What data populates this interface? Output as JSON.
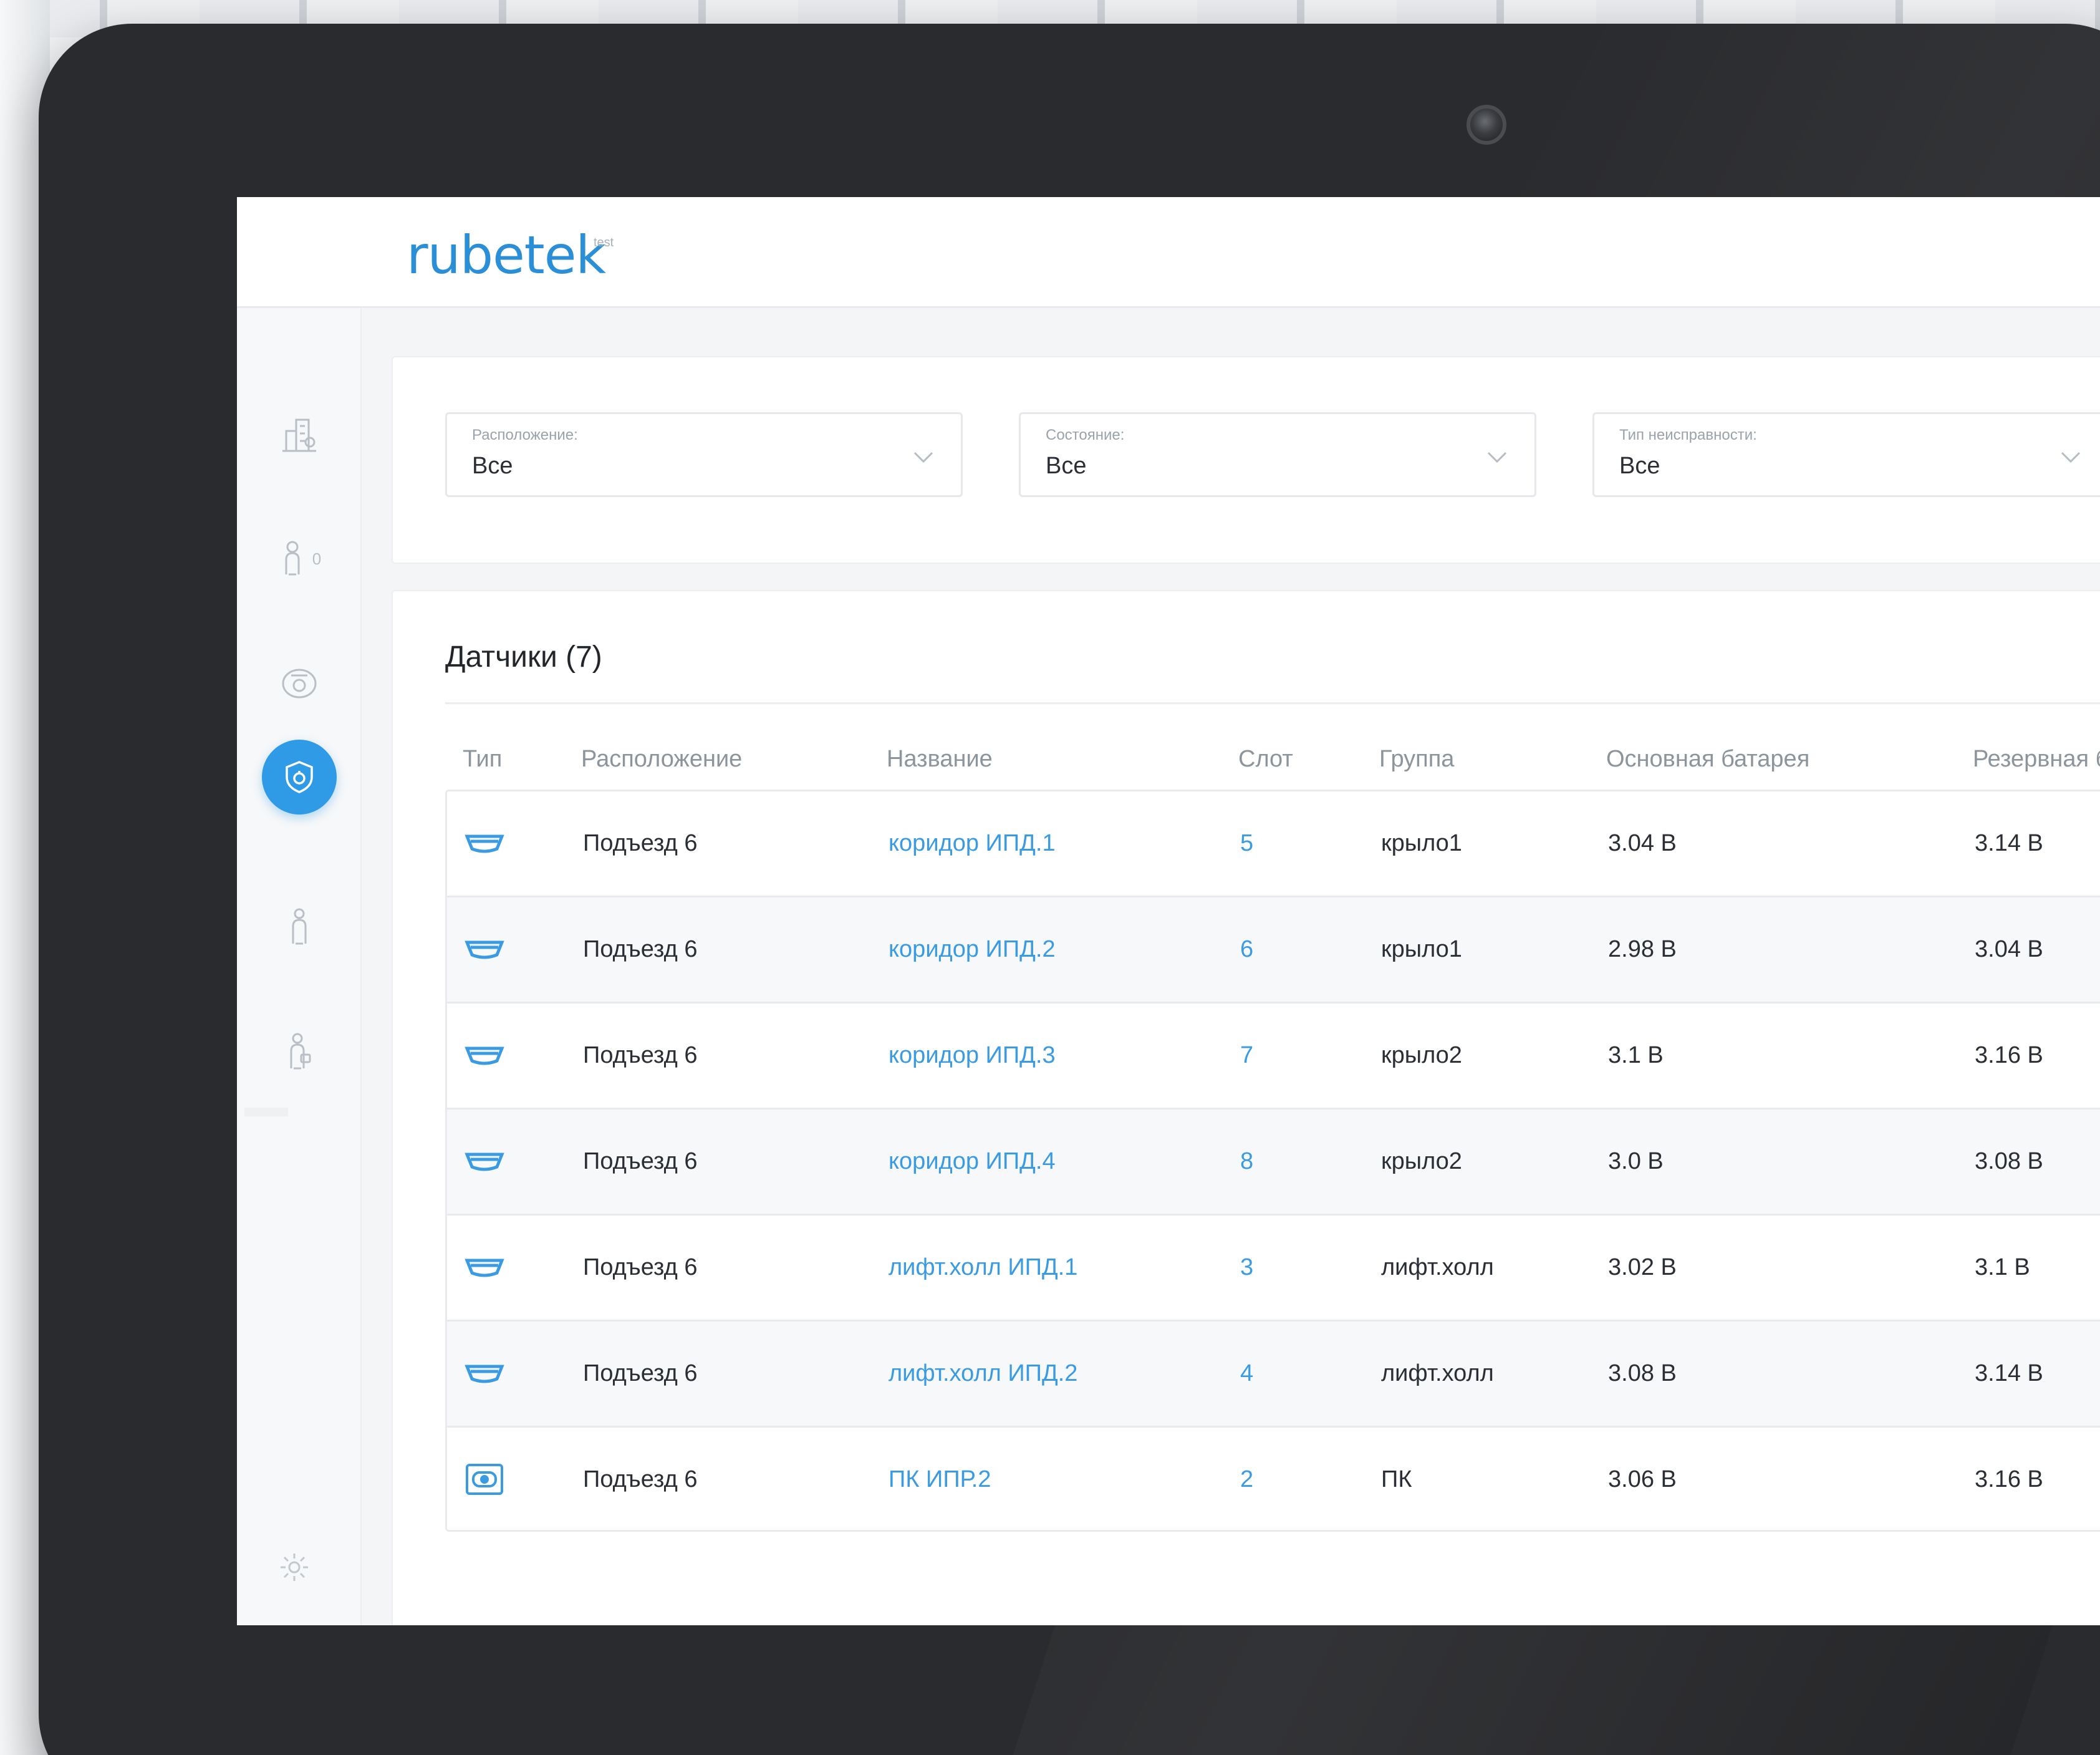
{
  "app": {
    "logo": "rubetek",
    "logo_sup": "test"
  },
  "sidebar": {
    "items": [
      {
        "icon": "building-icon"
      },
      {
        "icon": "residents-icon",
        "badge": "0"
      },
      {
        "icon": "camera-dome-icon"
      },
      {
        "icon": "shield-sensor-icon",
        "active": true
      },
      {
        "icon": "person-icon"
      },
      {
        "icon": "person-key-icon"
      }
    ],
    "footer_icon": "gear-icon"
  },
  "filters": [
    {
      "label": "Расположение:",
      "value": "Все"
    },
    {
      "label": "Состояние:",
      "value": "Все"
    },
    {
      "label": "Тип неисправности:",
      "value": "Все"
    }
  ],
  "table": {
    "title": "Датчики (7)",
    "columns": [
      "Тип",
      "Расположение",
      "Название",
      "Слот",
      "Группа",
      "Основная батарея",
      "Резервная бата"
    ],
    "rows": [
      {
        "type": "smoke-detector-icon",
        "location": "Подъезд 6",
        "name": "коридор ИПД.1",
        "slot": "5",
        "group": "крыло1",
        "main_battery": "3.04 В",
        "backup_battery": "3.14 В"
      },
      {
        "type": "smoke-detector-icon",
        "location": "Подъезд 6",
        "name": "коридор ИПД.2",
        "slot": "6",
        "group": "крыло1",
        "main_battery": "2.98 В",
        "backup_battery": "3.04 В"
      },
      {
        "type": "smoke-detector-icon",
        "location": "Подъезд 6",
        "name": "коридор ИПД.3",
        "slot": "7",
        "group": "крыло2",
        "main_battery": "3.1 В",
        "backup_battery": "3.16 В"
      },
      {
        "type": "smoke-detector-icon",
        "location": "Подъезд 6",
        "name": "коридор ИПД.4",
        "slot": "8",
        "group": "крыло2",
        "main_battery": "3.0 В",
        "backup_battery": "3.08 В"
      },
      {
        "type": "smoke-detector-icon",
        "location": "Подъезд 6",
        "name": "лифт.холл ИПД.1",
        "slot": "3",
        "group": "лифт.холл",
        "main_battery": "3.02 В",
        "backup_battery": "3.1 В"
      },
      {
        "type": "smoke-detector-icon",
        "location": "Подъезд 6",
        "name": "лифт.холл ИПД.2",
        "slot": "4",
        "group": "лифт.холл",
        "main_battery": "3.08 В",
        "backup_battery": "3.14 В"
      },
      {
        "type": "manual-call-point-icon",
        "location": "Подъезд 6",
        "name": "ПК ИПР.2",
        "slot": "2",
        "group": "ПК",
        "main_battery": "3.06 В",
        "backup_battery": "3.16 В"
      }
    ]
  },
  "colors": {
    "accent": "#2f9ae6",
    "link": "#3a9be3",
    "bezel": "#2a2b2e"
  }
}
